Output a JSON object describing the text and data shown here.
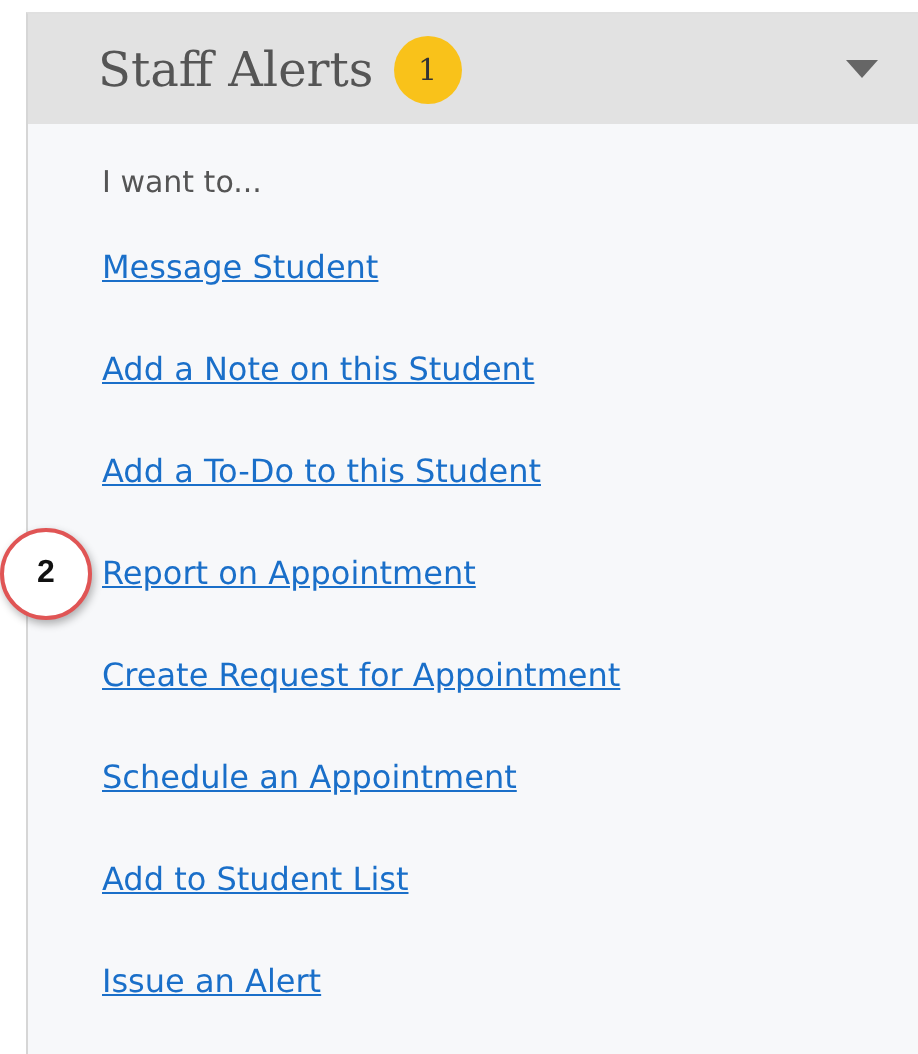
{
  "panel": {
    "title": "Staff Alerts",
    "badge": "1",
    "expanded": true
  },
  "intro": "I want to...",
  "links": [
    {
      "text": "Message Student"
    },
    {
      "text": "Add a Note on this Student"
    },
    {
      "text": "Add a To-Do to this Student"
    },
    {
      "text": "Report on Appointment",
      "callout": "2"
    },
    {
      "text": "Create Request for Appointment"
    },
    {
      "text": "Schedule an Appointment"
    },
    {
      "text": "Add to Student List"
    },
    {
      "text": "Issue an Alert"
    }
  ]
}
